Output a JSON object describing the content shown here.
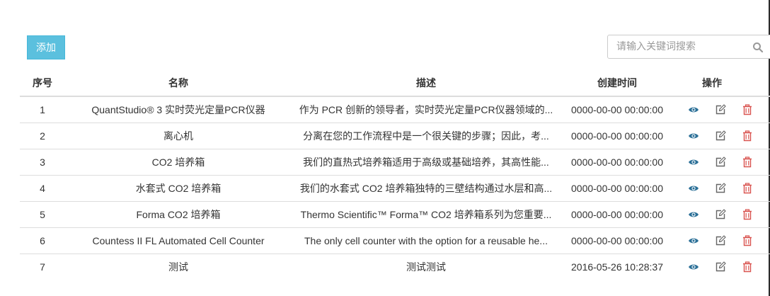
{
  "toolbar": {
    "add_label": "添加"
  },
  "search": {
    "placeholder": "请输入关键词搜索"
  },
  "table": {
    "headers": {
      "index": "序号",
      "name": "名称",
      "description": "描述",
      "created": "创建时间",
      "actions": "操作"
    },
    "rows": [
      {
        "index": "1",
        "name": "QuantStudio® 3 实时荧光定量PCR仪器",
        "description": "作为 PCR 创新的领导者，实时荧光定量PCR仪器领域的...",
        "created": "0000-00-00 00:00:00"
      },
      {
        "index": "2",
        "name": "离心机",
        "description": "分离在您的工作流程中是一个很关键的步骤；因此，考...",
        "created": "0000-00-00 00:00:00"
      },
      {
        "index": "3",
        "name": "CO2 培养箱",
        "description": "我们的直热式培养箱适用于高级或基础培养，其高性能...",
        "created": "0000-00-00 00:00:00"
      },
      {
        "index": "4",
        "name": "水套式 CO2 培养箱",
        "description": "我们的水套式 CO2 培养箱独特的三壁结构通过水层和高...",
        "created": "0000-00-00 00:00:00"
      },
      {
        "index": "5",
        "name": "Forma CO2 培养箱",
        "description": "Thermo Scientific™ Forma™ CO2 培养箱系列为您重要...",
        "created": "0000-00-00 00:00:00"
      },
      {
        "index": "6",
        "name": "Countess II FL Automated Cell Counter",
        "description": "The only cell counter with the option for a reusable he...",
        "created": "0000-00-00 00:00:00"
      },
      {
        "index": "7",
        "name": "测试",
        "description": "测试测试",
        "created": "2016-05-26 10:28:37"
      }
    ]
  },
  "icons": {
    "view": "eye-icon",
    "edit": "edit-icon",
    "delete": "trash-icon",
    "search": "search-icon"
  },
  "colors": {
    "add_button": "#5bc0de",
    "view_icon": "#2a6f97",
    "edit_icon": "#666666",
    "delete_icon": "#d9534f"
  }
}
